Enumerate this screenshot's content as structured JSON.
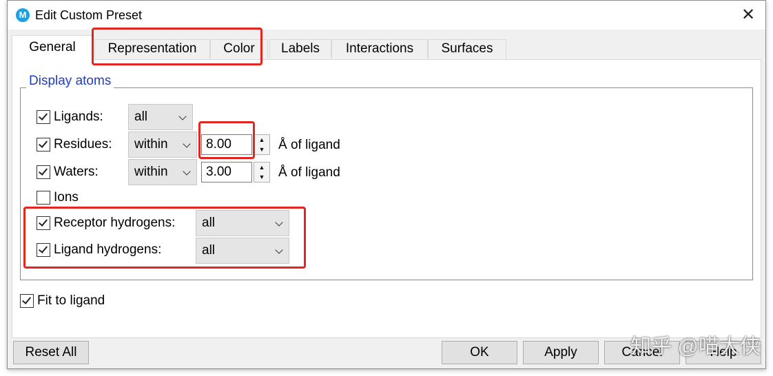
{
  "window": {
    "title": "Edit Custom Preset",
    "app_icon_letter": "M",
    "close_glyph": "✕"
  },
  "tabs": [
    {
      "label": "General",
      "active": true
    },
    {
      "label": "Representation",
      "active": false
    },
    {
      "label": "Color",
      "active": false
    },
    {
      "label": "Labels",
      "active": false
    },
    {
      "label": "Interactions",
      "active": false
    },
    {
      "label": "Surfaces",
      "active": false
    }
  ],
  "display_atoms": {
    "legend": "Display atoms",
    "ligands": {
      "label": "Ligands:",
      "checked": true,
      "mode": "all"
    },
    "residues": {
      "label": "Residues:",
      "checked": true,
      "mode": "within",
      "value": "8.00",
      "unit": "Å of ligand"
    },
    "waters": {
      "label": "Waters:",
      "checked": true,
      "mode": "within",
      "value": "3.00",
      "unit": "Å of ligand"
    },
    "ions": {
      "label": "Ions",
      "checked": false
    },
    "receptor_hydrogens": {
      "label": "Receptor hydrogens:",
      "checked": true,
      "mode": "all"
    },
    "ligand_hydrogens": {
      "label": "Ligand hydrogens:",
      "checked": true,
      "mode": "all"
    }
  },
  "fit_to_ligand": {
    "label": "Fit to ligand",
    "checked": true
  },
  "buttons": {
    "reset_all": "Reset All",
    "ok": "OK",
    "apply": "Apply",
    "cancel": "Cancel",
    "help": "Help"
  },
  "watermark": "知乎 @喵大侠",
  "colors": {
    "accent_blue": "#1f3ec6",
    "highlight_red": "#e0261e",
    "app_icon": "#1ba1e2"
  }
}
